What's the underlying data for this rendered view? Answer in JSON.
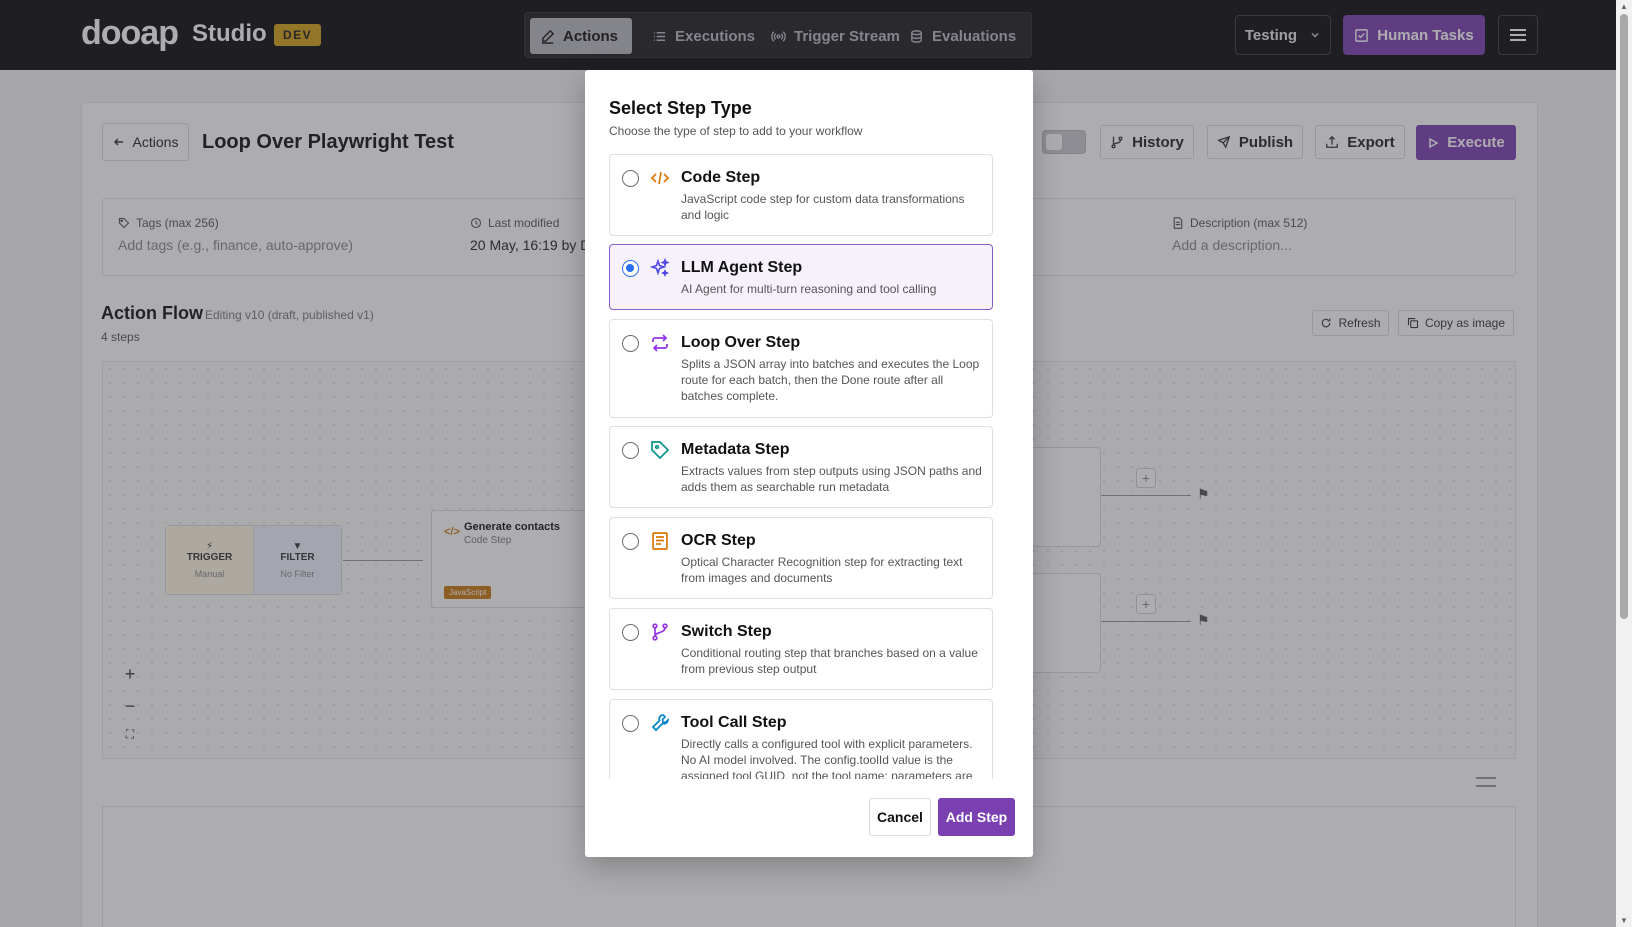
{
  "header": {
    "logo": "dooap",
    "studio": "Studio",
    "env_badge": "DEV",
    "tabs": [
      {
        "label": "Actions",
        "icon": "pencil-icon",
        "active": true
      },
      {
        "label": "Executions",
        "icon": "list-icon",
        "active": false
      },
      {
        "label": "Trigger Stream",
        "icon": "broadcast-icon",
        "active": false
      },
      {
        "label": "Evaluations",
        "icon": "database-icon",
        "active": false
      }
    ],
    "environment": "Testing",
    "human_tasks": "Human Tasks"
  },
  "action": {
    "back_label": "Actions",
    "title": "Loop Over Playwright Test",
    "toolbar": {
      "history": "History",
      "publish": "Publish",
      "export": "Export",
      "execute": "Execute"
    },
    "meta": {
      "tags_label": "Tags (max 256)",
      "tags_placeholder": "Add tags (e.g., finance, auto-approve)",
      "last_modified_label": "Last modified",
      "last_modified_value": "20 May, 16:19 by D",
      "description_label": "Description (max 512)",
      "description_placeholder": "Add a description..."
    },
    "flow": {
      "title": "Action Flow",
      "subtitle": "Editing v10 (draft, published v1)",
      "steps_count": "4 steps",
      "refresh": "Refresh",
      "copy_image": "Copy as image",
      "nodes": {
        "trigger": "TRIGGER",
        "trigger_sub": "Manual",
        "filter": "FILTER",
        "filter_sub": "No Filter",
        "code_name": "Generate contacts",
        "code_type": "Code Step",
        "code_badge": "JavaScript"
      }
    }
  },
  "modal": {
    "title": "Select Step Type",
    "subtitle": "Choose the type of step to add to your workflow",
    "options": [
      {
        "name": "Code Step",
        "desc": "JavaScript code step for custom data transformations and logic",
        "icon": "code-icon",
        "color": "#d97706",
        "selected": false
      },
      {
        "name": "LLM Agent Step",
        "desc": "AI Agent for multi-turn reasoning and tool calling",
        "icon": "sparkles-icon",
        "color": "#4f46e5",
        "selected": true
      },
      {
        "name": "Loop Over Step",
        "desc": "Splits a JSON array into batches and executes the Loop route for each batch, then the Done route after all batches complete.",
        "icon": "repeat-icon",
        "color": "#9333ea",
        "selected": false
      },
      {
        "name": "Metadata Step",
        "desc": "Extracts values from step outputs using JSON paths and adds them as searchable run metadata",
        "icon": "tag-icon",
        "color": "#0d9488",
        "selected": false
      },
      {
        "name": "OCR Step",
        "desc": "Optical Character Recognition step for extracting text from images and documents",
        "icon": "document-scan-icon",
        "color": "#d97706",
        "selected": false
      },
      {
        "name": "Switch Step",
        "desc": "Conditional routing step that branches based on a value from previous step output",
        "icon": "git-branch-icon",
        "color": "#9333ea",
        "selected": false
      },
      {
        "name": "Tool Call Step",
        "desc": "Directly calls a configured tool with explicit parameters. No AI model involved. The config.toolId value is the assigned tool GUID, not the tool name; parameters are",
        "icon": "wrench-icon",
        "color": "#0284c7",
        "selected": false
      }
    ],
    "cancel": "Cancel",
    "add": "Add Step"
  }
}
